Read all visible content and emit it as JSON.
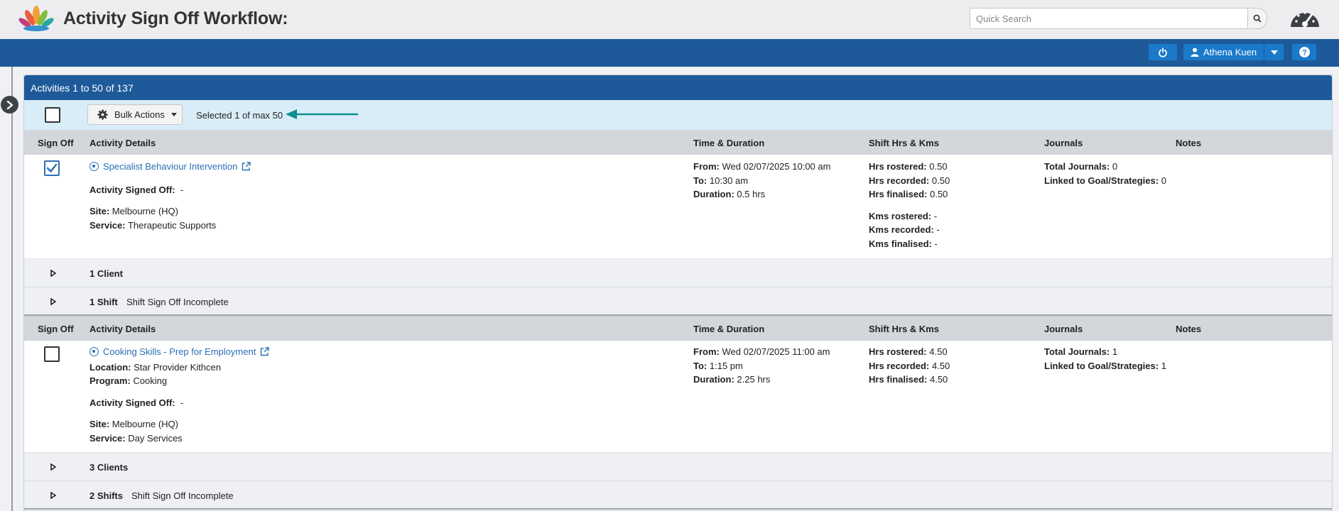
{
  "header": {
    "title": "Activity Sign Off Workflow:",
    "search_placeholder": "Quick Search",
    "user_name": "Athena Kuen"
  },
  "panel": {
    "title": "Activities 1 to 50 of 137",
    "bulk_actions_label": "Bulk Actions",
    "selected_text": "Selected 1 of max 50"
  },
  "columns": [
    "Sign Off",
    "Activity Details",
    "Time & Duration",
    "Shift Hrs & Kms",
    "Journals",
    "Notes"
  ],
  "activities": [
    {
      "name": "Specialist Behaviour Intervention",
      "checked": true,
      "signed_off_label": "Activity Signed Off:",
      "signed_off_value": "-",
      "site_label": "Site:",
      "site": "Melbourne (HQ)",
      "service_label": "Service:",
      "service": "Therapeutic Supports",
      "from_label": "From:",
      "from": "Wed 02/07/2025 10:00 am",
      "to_label": "To:",
      "to": "10:30 am",
      "duration_label": "Duration:",
      "duration": "0.5 hrs",
      "hrs_rostered_label": "Hrs rostered:",
      "hrs_rostered": "0.50",
      "hrs_recorded_label": "Hrs recorded:",
      "hrs_recorded": "0.50",
      "hrs_finalised_label": "Hrs finalised:",
      "hrs_finalised": "0.50",
      "kms_rostered_label": "Kms rostered:",
      "kms_rostered": "-",
      "kms_recorded_label": "Kms recorded:",
      "kms_recorded": "-",
      "kms_finalised_label": "Kms finalised:",
      "kms_finalised": "-",
      "total_journals_label": "Total Journals:",
      "total_journals": "0",
      "linked_label": "Linked to Goal/Strategies:",
      "linked": "0",
      "clients_label": "1 Client",
      "shifts_label": "1 Shift",
      "shift_status": "Shift Sign Off Incomplete"
    },
    {
      "name": "Cooking Skills - Prep for Employment",
      "checked": false,
      "location_label": "Location:",
      "location": "Star Provider Kithcen",
      "program_label": "Program:",
      "program": "Cooking",
      "signed_off_label": "Activity Signed Off:",
      "signed_off_value": "-",
      "site_label": "Site:",
      "site": "Melbourne (HQ)",
      "service_label": "Service:",
      "service": "Day Services",
      "from_label": "From:",
      "from": "Wed 02/07/2025 11:00 am",
      "to_label": "To:",
      "to": "1:15 pm",
      "duration_label": "Duration:",
      "duration": "2.25 hrs",
      "hrs_rostered_label": "Hrs rostered:",
      "hrs_rostered": "4.50",
      "hrs_recorded_label": "Hrs recorded:",
      "hrs_recorded": "4.50",
      "hrs_finalised_label": "Hrs finalised:",
      "hrs_finalised": "4.50",
      "total_journals_label": "Total Journals:",
      "total_journals": "1",
      "linked_label": "Linked to Goal/Strategies:",
      "linked": "1",
      "clients_label": "3 Clients",
      "shifts_label": "2 Shifts",
      "shift_status": "Shift Sign Off Incomplete"
    }
  ],
  "colors": {
    "brand_blue": "#1e5a9a",
    "button_blue": "#1a79c9",
    "bulk_bar": "#d9edf9",
    "link": "#2a6fb5",
    "arrow": "#0f8f8f"
  },
  "icons": [
    "lotus-logo",
    "search-icon",
    "dashboard-gauge-icon",
    "power-icon",
    "user-icon",
    "caret-down-icon",
    "help-icon",
    "chevron-right-icon",
    "gear-icon",
    "external-link-icon",
    "radio-dot-icon",
    "triangle-right-icon"
  ]
}
